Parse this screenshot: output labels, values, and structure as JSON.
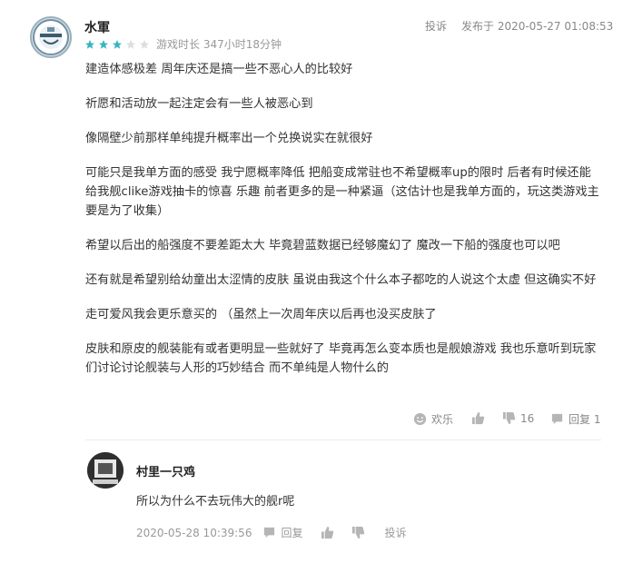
{
  "review": {
    "username": "水軍",
    "rating": 3,
    "max_rating": 5,
    "playtime": "游戏时长 347小时18分钟",
    "report_label": "投诉",
    "post_time": "发布于 2020-05-27 01:08:53",
    "paragraphs": [
      "建造体感极差 周年庆还是搞一些不恶心人的比较好",
      "祈愿和活动放一起注定会有一些人被恶心到",
      "像隔壁少前那样单纯提升概率出一个兑换说实在就很好",
      "可能只是我单方面的感受 我宁愿概率降低 把船变成常驻也不希望概率up的限时 后者有时候还能给我舰clike游戏抽卡的惊喜 乐趣 前者更多的是一种紧逼（这估计也是我单方面的，玩这类游戏主要是为了收集）",
      "希望以后出的船强度不要差距太大 毕竟碧蓝数据已经够魔幻了 魔改一下船的强度也可以吧",
      "还有就是希望别给幼童出太涩情的皮肤 虽说由我这个什么本子都吃的人说这个太虚 但这确实不好",
      "走可爱风我会更乐意买的 （虽然上一次周年庆以后再也没买皮肤了",
      "皮肤和原皮的舰装能有或者更明显一些就好了 毕竟再怎么变本质也是舰娘游戏 我也乐意听到玩家们讨论讨论舰装与人形的巧妙结合 而不单纯是人物什么的"
    ],
    "actions": {
      "funny_label": "欢乐",
      "dislike_count": "16",
      "reply_label": "回复 1"
    }
  },
  "reply": {
    "username": "村里一只鸡",
    "text": "所以为什么不去玩伟大的舰r呢",
    "time": "2020-05-28 10:39:56",
    "reply_label": "回复",
    "report_label": "投诉"
  },
  "colors": {
    "star_filled": "#3bb4c1",
    "star_empty": "#dddddd",
    "muted_text": "#888888",
    "icon_gray": "#aaaaaa"
  }
}
